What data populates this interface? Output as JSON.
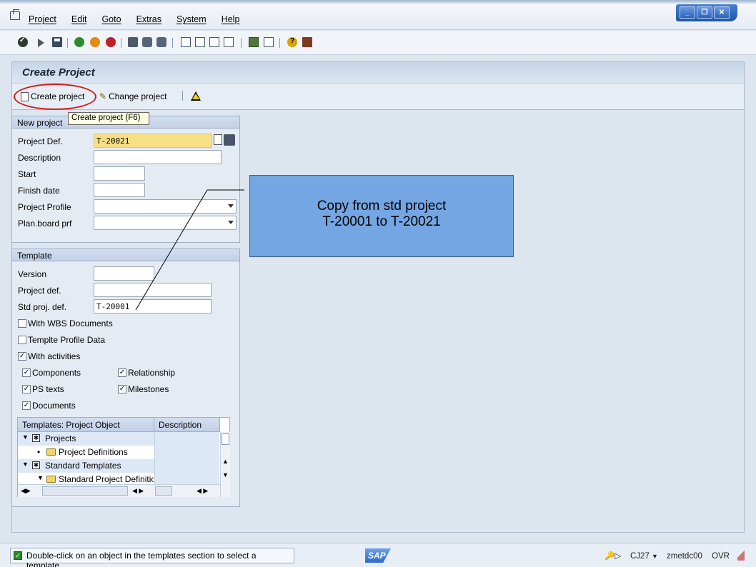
{
  "menu": {
    "items": [
      "Project",
      "Edit",
      "Goto",
      "Extras",
      "System",
      "Help"
    ]
  },
  "title": "Create Project",
  "app_toolbar": {
    "create_project": "Create project",
    "change_project": "Change project"
  },
  "tooltip": "Create project   (F6)",
  "new_project": {
    "header": "New project",
    "fields": [
      {
        "label": "Project Def.",
        "value": "T-20021"
      },
      {
        "label": "Description",
        "value": ""
      },
      {
        "label": "Start",
        "value": ""
      },
      {
        "label": "Finish date",
        "value": ""
      },
      {
        "label": "Project Profile",
        "value": ""
      },
      {
        "label": "Plan.board prf",
        "value": ""
      }
    ]
  },
  "template": {
    "header": "Template",
    "fields": [
      {
        "label": "Version",
        "value": ""
      },
      {
        "label": "Project def.",
        "value": ""
      },
      {
        "label": "Std proj. def.",
        "value": "T-20001"
      }
    ],
    "checkboxes": [
      {
        "label": "With WBS Documents",
        "checked": false
      },
      {
        "label": "Templte Profile Data",
        "checked": false
      },
      {
        "label": "With activities",
        "checked": true
      },
      {
        "label": "Components",
        "checked": true
      },
      {
        "label": "Relationship",
        "checked": true
      },
      {
        "label": "PS texts",
        "checked": true
      },
      {
        "label": "Milestones",
        "checked": true
      },
      {
        "label": "Documents",
        "checked": true
      }
    ]
  },
  "tree": {
    "col1": "Templates: Project Object",
    "col2": "Description",
    "rows": [
      "Projects",
      "Project Definitions",
      "Standard Templates",
      "Standard Project Definitio"
    ]
  },
  "callout": {
    "line1": "Copy from std project",
    "line2": "T-20001 to T-20021"
  },
  "status": {
    "message": "Double-click on an object in the templates section to select a template",
    "logo": "SAP",
    "transaction": "CJ27",
    "server": "zmetdc00",
    "mode": "OVR"
  }
}
